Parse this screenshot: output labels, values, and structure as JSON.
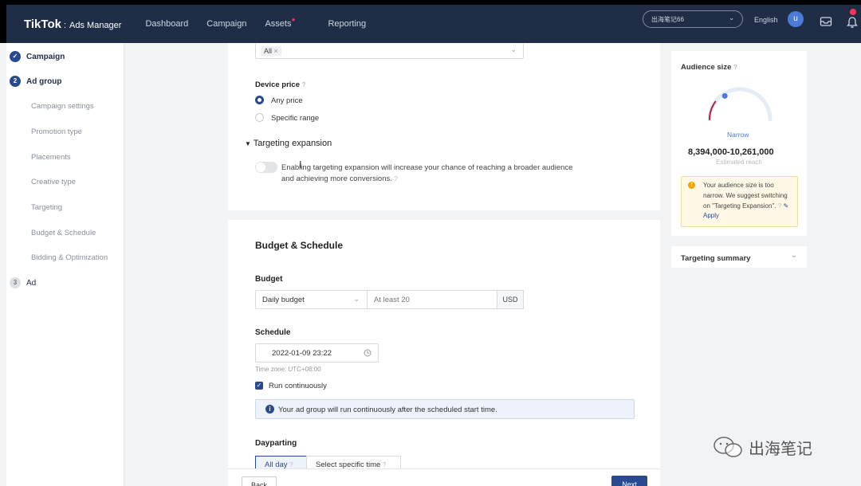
{
  "header": {
    "logo": "TikTok",
    "separator": ":",
    "product": "Ads Manager",
    "nav": [
      "Dashboard",
      "Campaign",
      "Assets",
      "Reporting"
    ],
    "account": "出海笔记66",
    "language": "English",
    "avatar": "u"
  },
  "sidebar": {
    "steps": [
      {
        "label": "Campaign",
        "icon": "check"
      },
      {
        "label": "Ad group",
        "icon": "2"
      }
    ],
    "substeps": [
      "Campaign settings",
      "Promotion type",
      "Placements",
      "Creative type",
      "Targeting",
      "Budget & Schedule",
      "Bidding & Optimization"
    ],
    "ad_step": {
      "num": "3",
      "label": "Ad"
    }
  },
  "targeting": {
    "tag": "All",
    "device_price_label": "Device price",
    "price_options": [
      "Any price",
      "Specific range"
    ],
    "expansion_title": "Targeting expansion",
    "expansion_desc_1": "Enabling targeting expansion will increase your chance of reaching a broader audience",
    "expansion_desc_2": "and achieving more conversions."
  },
  "budget": {
    "section_title": "Budget & Schedule",
    "budget_label": "Budget",
    "budget_type": "Daily budget",
    "amount_placeholder": "At least 20",
    "currency": "USD",
    "schedule_label": "Schedule",
    "start_datetime": "2022-01-09 23:22",
    "timezone": "Time zone: UTC+08:00",
    "run_continuously": "Run continuously",
    "info": "Your ad group will run continuously after the scheduled start time.",
    "dayparting_label": "Dayparting",
    "dayparting_options": [
      "All day",
      "Select specific time"
    ]
  },
  "footer": {
    "back": "Back",
    "next": "Next"
  },
  "audience": {
    "title": "Audience size",
    "level": "Narrow",
    "range": "8,394,000-10,261,000",
    "sub": "Estimated reach",
    "warning": "Your audience size is too narrow. We suggest switching on \"Targeting Expansion\".",
    "apply": "Apply",
    "level_fraction": 0.2
  },
  "summary": {
    "title": "Targeting summary"
  },
  "watermark": "出海笔记",
  "colors": {
    "header": "#1f2d46",
    "accent": "#2a4a8f",
    "warning": "#fff8e6"
  }
}
